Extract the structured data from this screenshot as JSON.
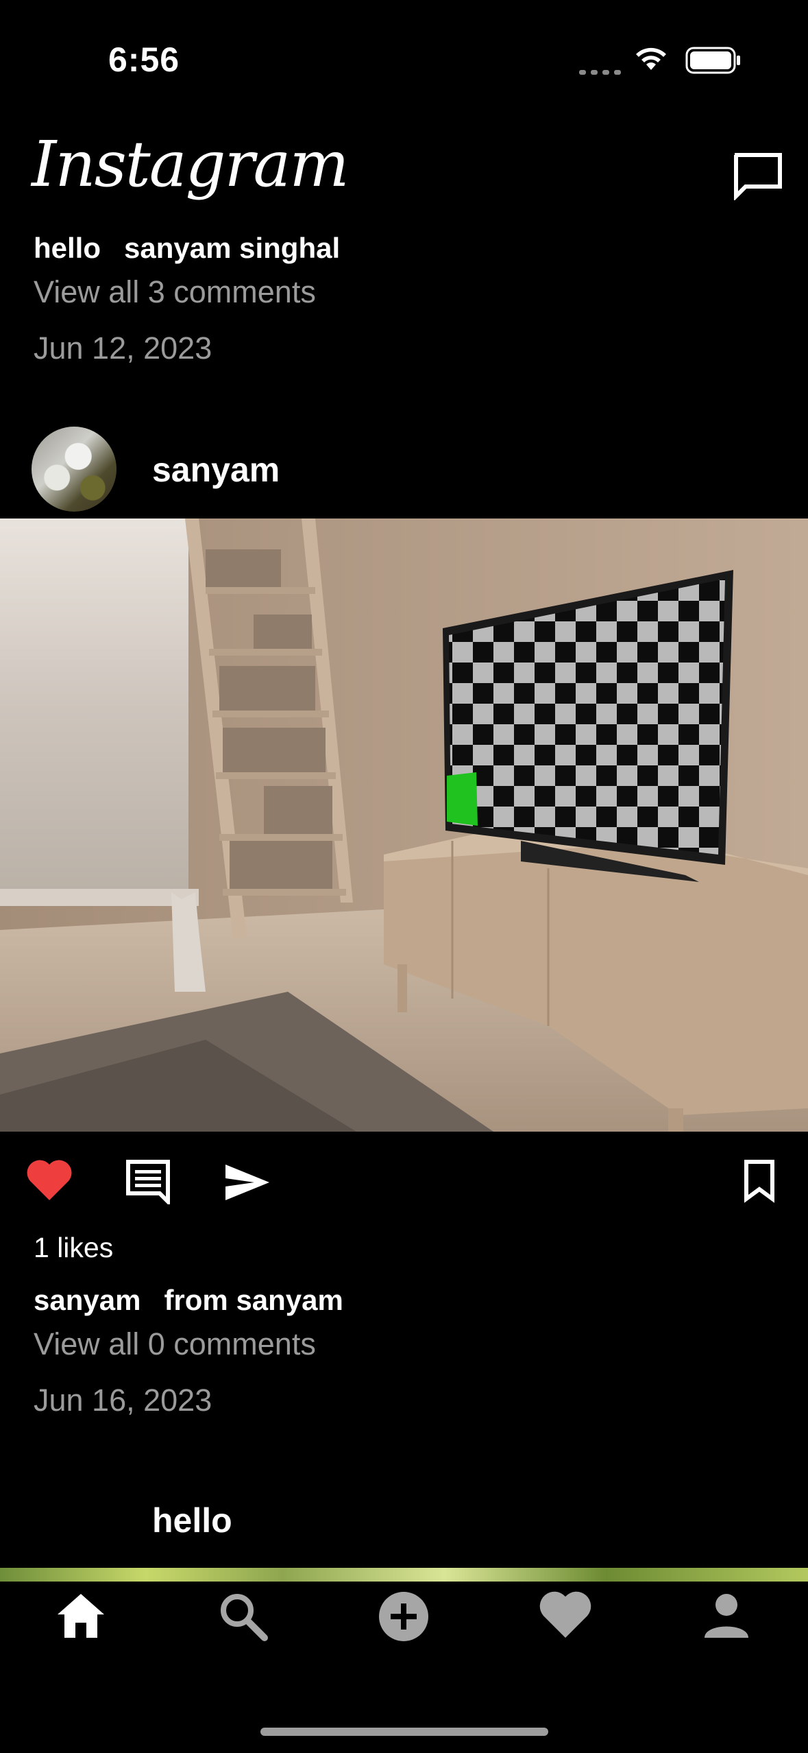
{
  "status_bar": {
    "time": "6:56"
  },
  "header": {
    "logo": "Instagram",
    "dm_icon": "message-square-icon"
  },
  "prev_post": {
    "caption_user": "hello",
    "caption_text": "sanyam singhal",
    "view_comments": "View all 3 comments",
    "date": "Jun 12, 2023"
  },
  "post": {
    "username": "sanyam",
    "likes": "1 likes",
    "caption_user": "sanyam",
    "caption_text": "from sanyam",
    "view_comments": "View all 0 comments",
    "date": "Jun 16, 2023",
    "liked": true,
    "like_color": "#ef3e3e"
  },
  "next_post": {
    "username": "hello"
  },
  "tabs": [
    {
      "icon": "home-icon"
    },
    {
      "icon": "search-icon"
    },
    {
      "icon": "add-circle-icon"
    },
    {
      "icon": "heart-icon"
    },
    {
      "icon": "profile-icon"
    }
  ]
}
